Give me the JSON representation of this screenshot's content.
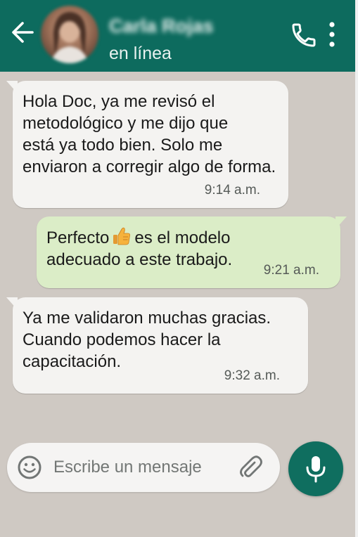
{
  "header": {
    "contact_name": "Carla Rojas",
    "status": "en línea",
    "icons": {
      "back": "back-arrow-icon",
      "call": "phone-icon",
      "menu": "more-vertical-icon"
    }
  },
  "messages": [
    {
      "direction": "incoming",
      "text": "Hola Doc, ya me revisó el\nmetodológico y me dijo que\nestá ya todo bien. Solo me\nenviaron a corregir algo de forma.",
      "time": "9:14 a.m."
    },
    {
      "direction": "outgoing",
      "text_before_emoji": "Perfecto",
      "emoji": "thumbs-up",
      "text_after_emoji": "es el modelo\nadecuado a este trabajo.",
      "time": "9:21 a.m."
    },
    {
      "direction": "incoming",
      "text": "Ya me validaron muchas gracias.\nCuando podemos hacer la\ncapacitación.",
      "time": "9:32 a.m."
    }
  ],
  "composer": {
    "placeholder": "Escribe un mensaje",
    "icons": {
      "emoji": "emoji-icon",
      "attach": "paperclip-icon",
      "mic": "microphone-icon"
    }
  },
  "colors": {
    "header": "#0d6b5e",
    "incoming_bubble": "#f4f3f1",
    "outgoing_bubble": "#dbedc7",
    "mic_button": "#0f6e5f"
  }
}
